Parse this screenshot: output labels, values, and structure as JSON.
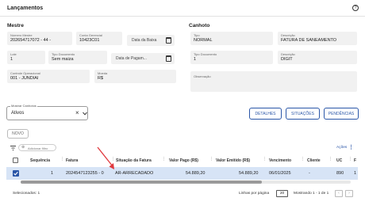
{
  "page": {
    "title": "Lançamentos"
  },
  "mestre": {
    "section_label": "Mestre",
    "numero_mestre": {
      "label": "Número Mestre",
      "value": "202654717072 - 44 -"
    },
    "conta_gerencial": {
      "label": "Conta Gerencial",
      "value": "10423C01"
    },
    "data_baixa": {
      "placeholder": "Data da Baixa"
    },
    "lote": {
      "label": "Lote",
      "value": "1"
    },
    "tipo_documento": {
      "label": "Tipo Documento",
      "value": "Sem maiza"
    },
    "data_pagamento": {
      "placeholder": "Data de Pagam..."
    },
    "controle_operacional": {
      "label": "Controle Operacional",
      "value": "001 - JUNDIAI"
    },
    "moeda": {
      "label": "Moeda",
      "value": "R$"
    }
  },
  "canhoto": {
    "section_label": "Canhoto",
    "tipo": {
      "label": "Tipo",
      "value": "NORMAL"
    },
    "descricao": {
      "label": "Descrição",
      "value": "FATURA DE SANEAMENTO"
    },
    "tipo_documento": {
      "label": "Tipo Documento",
      "value": "1"
    },
    "descricao2": {
      "label": "Descrição",
      "value": "DIGIT"
    },
    "observacao": {
      "label": "Observação",
      "value": ""
    }
  },
  "filter": {
    "label": "Mostrar Canhotos",
    "value": "Ativos"
  },
  "actions": {
    "detalhes": "DETALHES",
    "situacoes": "SITUAÇÕES",
    "pendencias": "PENDÊNCIAS"
  },
  "novo_label": "NOVO",
  "table": {
    "add_filter": "Adicionar filtro",
    "acoes": "Ações",
    "columns": {
      "sequencia": "Sequência",
      "fatura": "Fatura",
      "situacao": "Situação da Fatura",
      "valor_pago": "Valor Pago (R$)",
      "valor_emitido": "Valor Emitido (R$)",
      "vencimento": "Vencimento",
      "cliente": "Cliente",
      "uc": "UC",
      "extra": "F"
    },
    "rows": [
      {
        "sequencia": "1",
        "fatura": "2024547123255 - 0",
        "situacao": "AR-ARRECADADO",
        "valor_pago": "54.889,20",
        "valor_emitido": "54.889,20",
        "vencimento": "06/01/2025",
        "cliente": "-",
        "uc": "890",
        "extra": "1"
      }
    ]
  },
  "footer": {
    "selecionados": "Selecionados: 1",
    "linhas_label": "Linhas por página",
    "linhas_value": "20",
    "mostrando": "Mostrando 1 - 1 de 1"
  },
  "colors": {
    "accent": "#2a56a8",
    "row_selected": "#d7e4f6",
    "arrow": "#e0393e"
  }
}
